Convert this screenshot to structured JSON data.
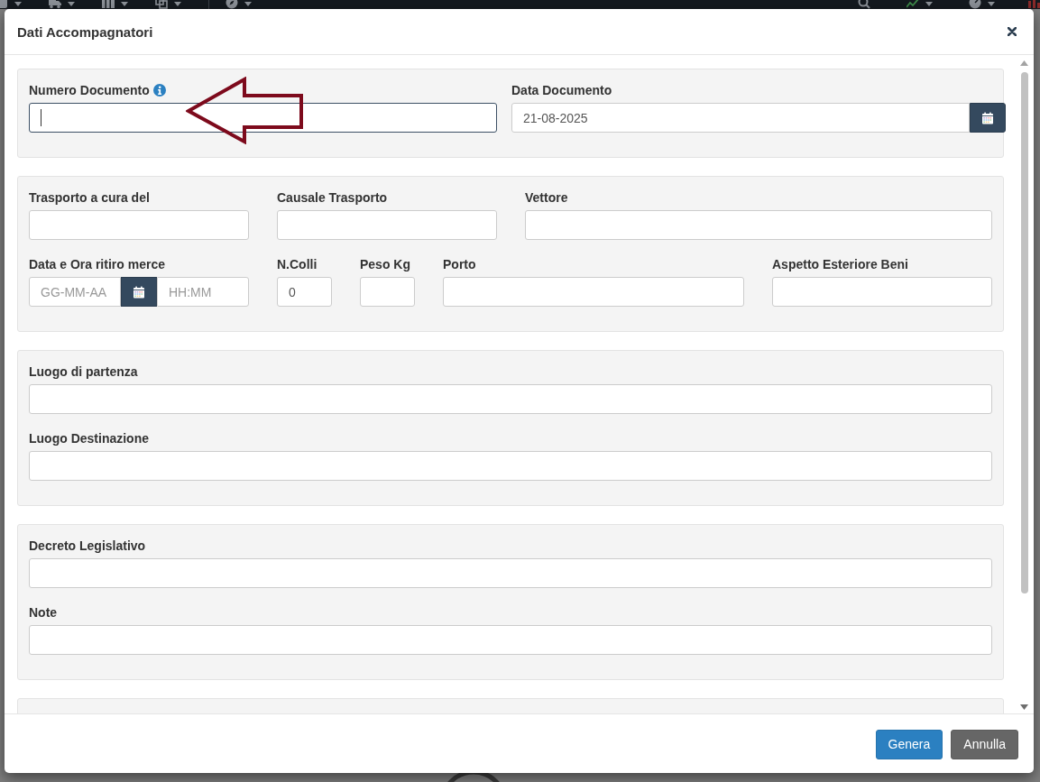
{
  "window": {
    "title": "Dati Accompagnatori"
  },
  "panels": [
    {
      "rows": [
        {
          "fields": [
            {
              "kind": "text",
              "label": "Numero Documento",
              "info": true,
              "focused": true,
              "arrow": true
            },
            {
              "kind": "date",
              "label": "Data Documento",
              "value": "21-08-2025",
              "info": false,
              "focused": false,
              "arrow": false
            }
          ]
        }
      ]
    },
    {
      "rows": [
        {
          "fields": [
            {
              "kind": "text",
              "label": "Trasporto a cura del",
              "info": false,
              "focused": false,
              "arrow": false
            },
            {
              "kind": "text",
              "label": "Causale Trasporto",
              "info": false,
              "focused": false,
              "arrow": false
            },
            {
              "kind": "text",
              "label": "Vettore",
              "info": false,
              "focused": false,
              "arrow": false
            }
          ]
        },
        {
          "fields": [
            {
              "kind": "datetime",
              "label": "Data e Ora ritiro merce",
              "date_placeholder": "GG-MM-AA",
              "time_placeholder": "HH:MM",
              "info": false,
              "focused": false,
              "arrow": false
            },
            {
              "kind": "text",
              "label": "N.Colli",
              "value": "0",
              "info": false,
              "focused": false,
              "arrow": false
            },
            {
              "kind": "text",
              "label": "Peso Kg",
              "info": false,
              "focused": false,
              "arrow": false
            },
            {
              "kind": "text",
              "label": "Porto",
              "info": false,
              "focused": false,
              "arrow": false
            },
            {
              "kind": "text",
              "label": "Aspetto Esteriore Beni",
              "info": false,
              "focused": false,
              "arrow": false
            }
          ]
        }
      ]
    },
    {
      "rows": [
        {
          "fields": [
            {
              "kind": "text",
              "label": "Luogo di partenza",
              "info": false,
              "focused": false,
              "arrow": false
            }
          ]
        },
        {
          "fields": [
            {
              "kind": "text",
              "label": "Luogo Destinazione",
              "info": false,
              "focused": false,
              "arrow": false
            }
          ]
        }
      ]
    },
    {
      "rows": [
        {
          "fields": [
            {
              "kind": "text",
              "label": "Decreto Legislativo",
              "info": false,
              "focused": false,
              "arrow": false
            }
          ]
        },
        {
          "fields": [
            {
              "kind": "text",
              "label": "Note",
              "info": false,
              "focused": false,
              "arrow": false
            }
          ]
        }
      ]
    }
  ],
  "buttons": [
    {
      "label": "Genera",
      "kind": "primary"
    },
    {
      "label": "Annulla",
      "kind": "secondary"
    }
  ]
}
